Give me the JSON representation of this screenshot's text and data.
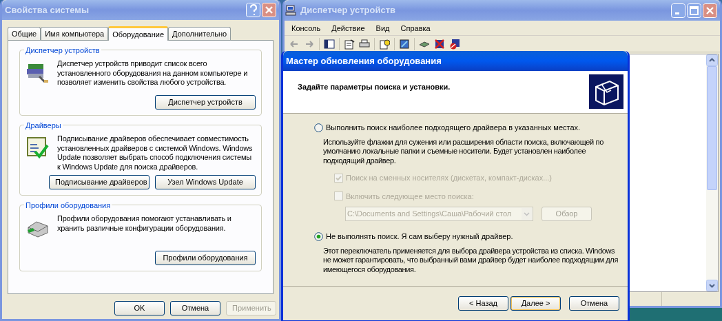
{
  "system_properties": {
    "title": "Свойства системы",
    "active": false,
    "tabs": [
      {
        "label": "Общие",
        "selected": false
      },
      {
        "label": "Имя компьютера",
        "selected": false
      },
      {
        "label": "Оборудование",
        "selected": true
      },
      {
        "label": "Дополнительно",
        "selected": false
      }
    ],
    "groups": [
      {
        "kind": "devices",
        "title": "Диспетчер устройств",
        "description": "Диспетчер устройств приводит список всего установленного оборудования на данном компьютере и позволяет изменить свойства любого устройства.",
        "buttons": [
          "Диспетчер устройств"
        ]
      },
      {
        "kind": "drivers",
        "title": "Драйверы",
        "description": "Подписывание драйверов обеспечивает совместимость установленных драйверов с системой Windows.  Windows Update позволяет выбрать способ подключения системы к Windows Update для поиска драйверов.",
        "buttons": [
          "Подписывание драйверов",
          "Узел Windows Update"
        ]
      },
      {
        "kind": "profiles",
        "title": "Профили оборудования",
        "description": "Профили оборудования помогают устанавливать и хранить различные конфигурации оборудования.",
        "buttons": [
          "Профили оборудования"
        ]
      }
    ],
    "footer_buttons": [
      {
        "label": "OK",
        "disabled": false
      },
      {
        "label": "Отмена",
        "disabled": false
      },
      {
        "label": "Применить",
        "disabled": true
      }
    ]
  },
  "device_manager": {
    "title": "Диспетчер устройств",
    "active": false,
    "menu": [
      "Консоль",
      "Действие",
      "Вид",
      "Справка"
    ]
  },
  "wizard": {
    "title": "Мастер обновления оборудования",
    "active": true,
    "heading": "Задайте параметры поиска и установки.",
    "options": [
      {
        "label": "Выполнить поиск наиболее подходящего драйвера в указанных местах.",
        "selected": false,
        "description": "Используйте флажки для сужения или расширения области поиска, включающей по умолчанию локальные папки и съемные носители. Будет установлен наиболее подходящий драйвер."
      },
      {
        "label": "Не выполнять поиск. Я сам выберу нужный драйвер.",
        "selected": true,
        "description": "Этот переключатель применяется для выбора драйвера устройства из списка. Windows не может гарантировать, что выбранный вами драйвер будет наиболее подходящим для имеющегося оборудования."
      }
    ],
    "checkboxes": [
      {
        "label": "Поиск на сменных носителях (дискетах, компакт-дисках...)",
        "checked": true,
        "disabled": true
      },
      {
        "label": "Включить следующее место поиска:",
        "checked": false,
        "disabled": true
      }
    ],
    "location_field": {
      "value": "C:\\Documents and Settings\\Саша\\Рабочий стол",
      "disabled": true
    },
    "browse_button": {
      "label": "Обзор",
      "disabled": true
    },
    "buttons": [
      {
        "label": "< Назад",
        "default": false
      },
      {
        "label": "Далее >",
        "default": true
      },
      {
        "label": "Отмена",
        "default": false
      }
    ]
  }
}
